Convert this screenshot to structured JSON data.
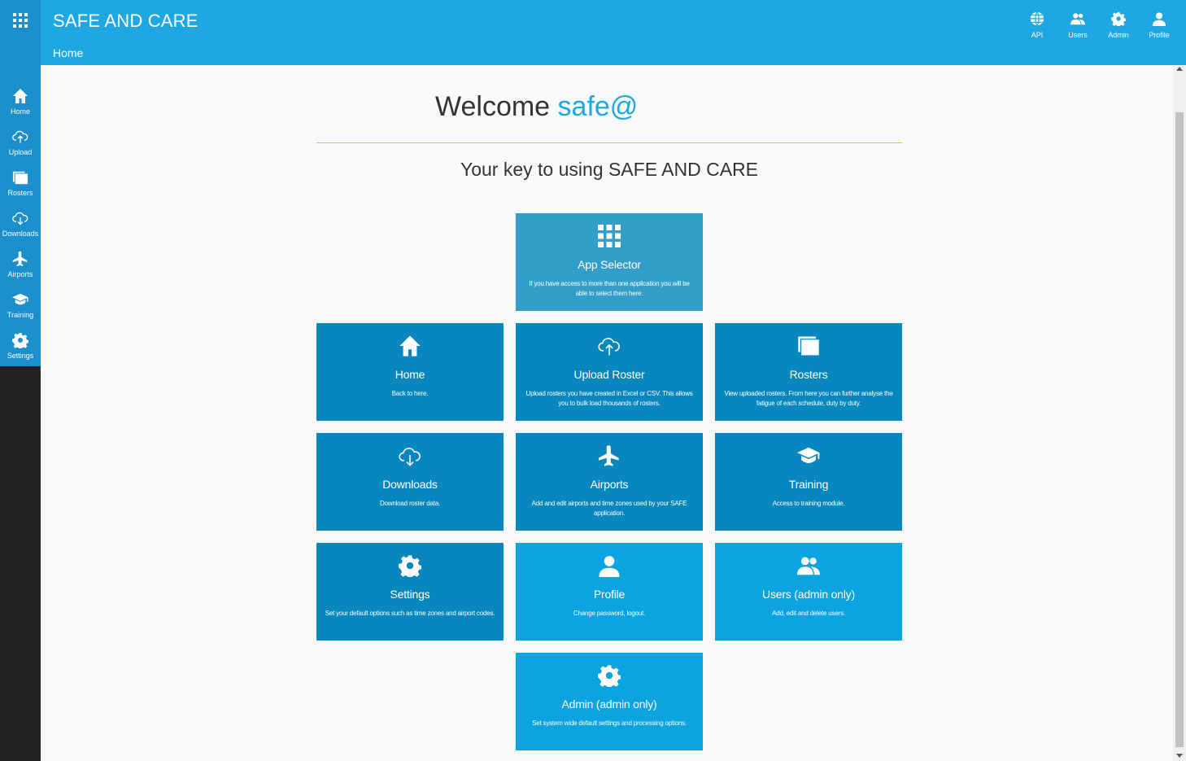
{
  "header": {
    "brand": "SAFE AND CARE",
    "breadcrumb": "Home",
    "actions": [
      {
        "label": "API",
        "icon": "globe-icon"
      },
      {
        "label": "Users",
        "icon": "users-icon"
      },
      {
        "label": "Admin",
        "icon": "gear-icon"
      },
      {
        "label": "Profile",
        "icon": "user-icon"
      }
    ]
  },
  "sidebar": {
    "items": [
      {
        "label": "Home",
        "icon": "home-icon"
      },
      {
        "label": "Upload",
        "icon": "cloud-upload-icon"
      },
      {
        "label": "Rosters",
        "icon": "rosters-icon"
      },
      {
        "label": "Downloads",
        "icon": "cloud-download-icon"
      },
      {
        "label": "Airports",
        "icon": "plane-icon"
      },
      {
        "label": "Training",
        "icon": "graduation-cap-icon"
      },
      {
        "label": "Settings",
        "icon": "gear-icon"
      }
    ]
  },
  "main": {
    "welcome_prefix": "Welcome",
    "welcome_user": "safe@",
    "tagline": "Your key to using SAFE AND CARE",
    "tiles": [
      {
        "title": "App Selector",
        "desc": "If you have access to more than one application you will be able to select them here.",
        "icon": "grid-icon",
        "color": "#339ec9"
      },
      {
        "title": "Home",
        "desc": "Back to here.",
        "icon": "home-icon",
        "color": "#0887bf"
      },
      {
        "title": "Upload Roster",
        "desc": "Upload rosters you have created in Excel or CSV. This allows you to bulk load thousands of rosters.",
        "icon": "cloud-upload-icon",
        "color": "#0887bf"
      },
      {
        "title": "Rosters",
        "desc": "View uploaded rosters. From here you can further analyse the fatigue of each schedule, duty by duty.",
        "icon": "rosters-icon",
        "color": "#0887bf"
      },
      {
        "title": "Downloads",
        "desc": "Download roster data.",
        "icon": "cloud-download-icon",
        "color": "#0887bf"
      },
      {
        "title": "Airports",
        "desc": "Add and edit airports and time zones used by your SAFE application.",
        "icon": "plane-icon",
        "color": "#0887bf"
      },
      {
        "title": "Training",
        "desc": "Access to training module.",
        "icon": "graduation-cap-icon",
        "color": "#0887bf"
      },
      {
        "title": "Settings",
        "desc": "Set your default options such as time zones and airport codes.",
        "icon": "gear-icon",
        "color": "#0887bf"
      },
      {
        "title": "Profile",
        "desc": "Change password, logout.",
        "icon": "user-icon",
        "color": "#0ba3e0"
      },
      {
        "title": "Users (admin only)",
        "desc": "Add, edit and delete users.",
        "icon": "users-icon",
        "color": "#0ba3e0"
      },
      {
        "title": "Admin (admin only)",
        "desc": "Set system wide default settings and processing options.",
        "icon": "gear-icon",
        "color": "#0ba3e0"
      }
    ]
  }
}
